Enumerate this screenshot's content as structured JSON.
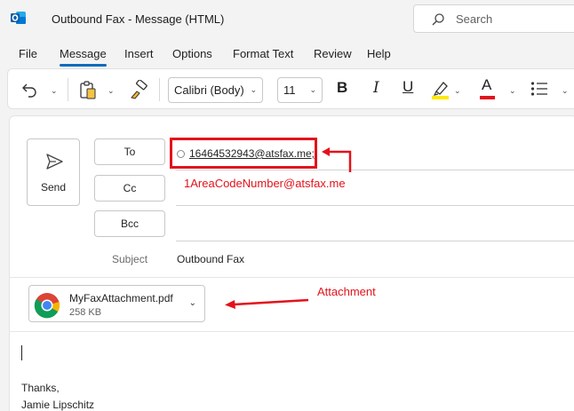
{
  "window": {
    "title": "Outbound Fax  -  Message (HTML)",
    "app_icon": "outlook-icon",
    "search_placeholder": "Search"
  },
  "menu": {
    "items": [
      "File",
      "Message",
      "Insert",
      "Options",
      "Format Text",
      "Review",
      "Help"
    ],
    "active": "Message"
  },
  "ribbon": {
    "font_family": "Calibri (Body)",
    "font_size": "11",
    "bold_glyph": "B",
    "italic_glyph": "I",
    "underline_glyph": "U",
    "font_color_glyph": "A",
    "highlight_color": "#ffe800",
    "font_color": "#e3121b",
    "icons": [
      "undo-icon",
      "paste-icon",
      "format-painter-icon",
      "highlight-icon",
      "font-color-icon",
      "bullets-icon"
    ]
  },
  "compose": {
    "send_label": "Send",
    "to_label": "To",
    "cc_label": "Cc",
    "bcc_label": "Bcc",
    "to_recipient": "16464532943@atsfax.me;",
    "subject_label": "Subject",
    "subject_value": "Outbound Fax"
  },
  "attachment": {
    "name": "MyFaxAttachment.pdf",
    "size": "258 KB",
    "icon": "chrome-icon"
  },
  "annotations": {
    "recipient_note": "1AreaCodeNumber@atsfax.me",
    "attachment_note": "Attachment",
    "color": "#e3121b"
  },
  "body": {
    "lines": [
      "Thanks,",
      "Jamie Lipschitz"
    ]
  }
}
